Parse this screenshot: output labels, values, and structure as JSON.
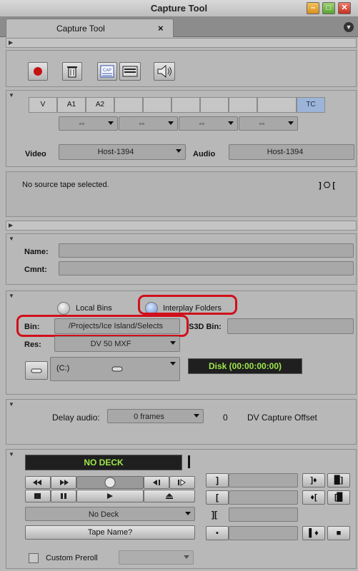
{
  "window": {
    "title": "Capture Tool",
    "min": "–",
    "max": "□",
    "close": "✕"
  },
  "tab": {
    "label": "Capture Tool",
    "close": "×",
    "menu_icon": "▼"
  },
  "tracks": [
    "V",
    "A1",
    "A2",
    "",
    "",
    "",
    "",
    "",
    "",
    "TC"
  ],
  "channel_selects": [
    "◦◦",
    "◦◦",
    "◦◦",
    "◦◦"
  ],
  "video": {
    "label": "Video",
    "value": "Host-1394"
  },
  "audio": {
    "label": "Audio",
    "value": "Host-1394"
  },
  "source": {
    "message": "No source tape selected.",
    "marks": "] ⎔ ["
  },
  "clip": {
    "name_label": "Name:",
    "cmnt_label": "Cmnt:"
  },
  "target": {
    "local_bins": "Local Bins",
    "interplay_folders": "Interplay Folders",
    "bin_label": "Bin:",
    "bin_value": "/Projects/Ice Island/Selects",
    "s3d_bin_label": "S3D Bin:",
    "res_label": "Res:",
    "res_value": "DV 50  MXF",
    "drive_value": "(C:)",
    "disk_time": "Disk (00:00:00:00)"
  },
  "delay": {
    "label": "Delay audio:",
    "value": "0 frames",
    "offset_value": "0",
    "offset_label": "DV Capture Offset"
  },
  "deck": {
    "status": "NO DECK",
    "deck_select": "No Deck",
    "tape_name": "Tape Name?",
    "custom_preroll": "Custom Preroll"
  },
  "colors": {
    "accent_red": "#d0101a",
    "disk_green": "#9fe84a",
    "tc_blue": "#9cb4d8"
  }
}
